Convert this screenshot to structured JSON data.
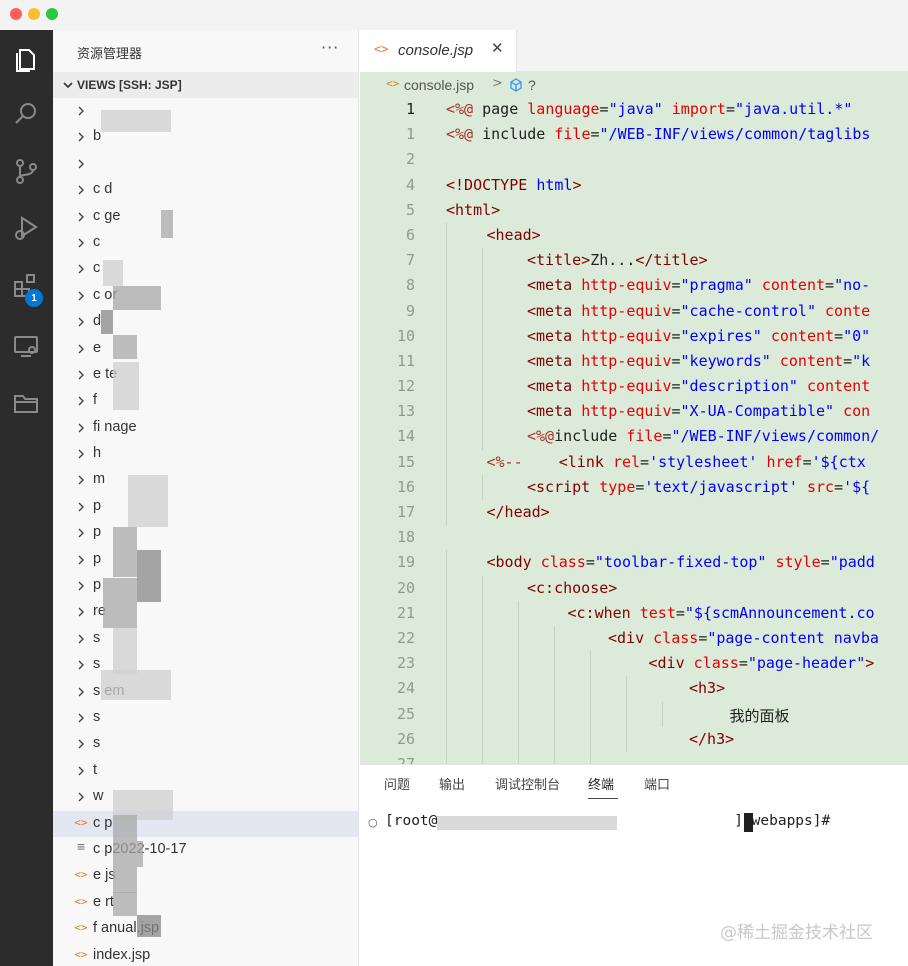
{
  "sidebar": {
    "title": "资源管理器",
    "more": "···",
    "section_label": "VIEWS [SSH: JSP]",
    "items": [
      {
        "label": "",
        "kind": "folder"
      },
      {
        "label": "b",
        "kind": "folder"
      },
      {
        "label": "",
        "kind": "folder"
      },
      {
        "label": "c    d",
        "kind": "folder"
      },
      {
        "label": "c             ge",
        "kind": "folder"
      },
      {
        "label": "c",
        "kind": "folder"
      },
      {
        "label": "c",
        "kind": "folder"
      },
      {
        "label": "c            or",
        "kind": "folder"
      },
      {
        "label": "d",
        "kind": "folder"
      },
      {
        "label": "e",
        "kind": "folder"
      },
      {
        "label": "e           te",
        "kind": "folder"
      },
      {
        "label": "f",
        "kind": "folder"
      },
      {
        "label": "fi                  nage",
        "kind": "folder"
      },
      {
        "label": "h",
        "kind": "folder"
      },
      {
        "label": "m",
        "kind": "folder"
      },
      {
        "label": "p",
        "kind": "folder"
      },
      {
        "label": "p",
        "kind": "folder"
      },
      {
        "label": "p",
        "kind": "folder"
      },
      {
        "label": "p",
        "kind": "folder"
      },
      {
        "label": "re",
        "kind": "folder"
      },
      {
        "label": "s",
        "kind": "folder"
      },
      {
        "label": "s",
        "kind": "folder"
      },
      {
        "label": "s                 em",
        "kind": "folder"
      },
      {
        "label": "s",
        "kind": "folder"
      },
      {
        "label": "s",
        "kind": "folder"
      },
      {
        "label": "t",
        "kind": "folder"
      },
      {
        "label": "w",
        "kind": "folder"
      },
      {
        "label": "c               p",
        "kind": "jsp"
      },
      {
        "label": "c            p2022-10-17",
        "kind": "text"
      },
      {
        "label": "e      js",
        "kind": "jsp"
      },
      {
        "label": "e      rt",
        "kind": "jsp"
      },
      {
        "label": "f         anual.jsp",
        "kind": "jsp"
      },
      {
        "label": "index.jsp",
        "kind": "jsp"
      }
    ],
    "selected_index": 27
  },
  "activity_badge": "1",
  "tab": {
    "icon": "<>",
    "label": "console.jsp",
    "close": "✕"
  },
  "breadcrumb": {
    "icon": "<>",
    "file": "console.jsp",
    "sep": ">",
    "tail": "?"
  },
  "code": [
    {
      "n": "1",
      "active": true,
      "indent": 0,
      "tokens": [
        [
          "jsp",
          "<%@"
        ],
        [
          "txt",
          " page "
        ],
        [
          "attr",
          "language"
        ],
        [
          "txt",
          "="
        ],
        [
          "str",
          "\"java\""
        ],
        [
          "txt",
          " "
        ],
        [
          "attr",
          "import"
        ],
        [
          "txt",
          "="
        ],
        [
          "str",
          "\"java.util.*\""
        ]
      ]
    },
    {
      "n": "1",
      "indent": 0,
      "tokens": [
        [
          "jsp",
          "<%@"
        ],
        [
          "txt",
          " include "
        ],
        [
          "attr",
          "file"
        ],
        [
          "txt",
          "="
        ],
        [
          "str",
          "\"/WEB-INF/views/common/taglibs"
        ]
      ]
    },
    {
      "n": "2",
      "indent": 0,
      "tokens": []
    },
    {
      "n": "4",
      "indent": 0,
      "tokens": [
        [
          "doc",
          "<!DOCTYPE"
        ],
        [
          "txt",
          " "
        ],
        [
          "str",
          "html"
        ],
        [
          "doc",
          ">"
        ]
      ]
    },
    {
      "n": "5",
      "indent": 0,
      "tokens": [
        [
          "tag",
          "<html>"
        ]
      ]
    },
    {
      "n": "6",
      "indent": 1,
      "tokens": [
        [
          "tag",
          "<head>"
        ]
      ]
    },
    {
      "n": "7",
      "indent": 2,
      "tokens": [
        [
          "tag",
          "<title>"
        ],
        [
          "txt",
          "Zh..."
        ],
        [
          "tag",
          "</title>"
        ]
      ]
    },
    {
      "n": "8",
      "indent": 2,
      "tokens": [
        [
          "tag",
          "<meta "
        ],
        [
          "attr",
          "http-equiv"
        ],
        [
          "txt",
          "="
        ],
        [
          "str",
          "\"pragma\""
        ],
        [
          "txt",
          " "
        ],
        [
          "attr",
          "content"
        ],
        [
          "txt",
          "="
        ],
        [
          "str",
          "\"no-"
        ]
      ]
    },
    {
      "n": "9",
      "indent": 2,
      "tokens": [
        [
          "tag",
          "<meta "
        ],
        [
          "attr",
          "http-equiv"
        ],
        [
          "txt",
          "="
        ],
        [
          "str",
          "\"cache-control\""
        ],
        [
          "txt",
          " "
        ],
        [
          "attr",
          "conte"
        ]
      ]
    },
    {
      "n": "10",
      "indent": 2,
      "tokens": [
        [
          "tag",
          "<meta "
        ],
        [
          "attr",
          "http-equiv"
        ],
        [
          "txt",
          "="
        ],
        [
          "str",
          "\"expires\""
        ],
        [
          "txt",
          " "
        ],
        [
          "attr",
          "content"
        ],
        [
          "txt",
          "="
        ],
        [
          "str",
          "\"0\""
        ]
      ]
    },
    {
      "n": "11",
      "indent": 2,
      "tokens": [
        [
          "tag",
          "<meta "
        ],
        [
          "attr",
          "http-equiv"
        ],
        [
          "txt",
          "="
        ],
        [
          "str",
          "\"keywords\""
        ],
        [
          "txt",
          " "
        ],
        [
          "attr",
          "content"
        ],
        [
          "txt",
          "="
        ],
        [
          "str",
          "\"k"
        ]
      ]
    },
    {
      "n": "12",
      "indent": 2,
      "tokens": [
        [
          "tag",
          "<meta "
        ],
        [
          "attr",
          "http-equiv"
        ],
        [
          "txt",
          "="
        ],
        [
          "str",
          "\"description\""
        ],
        [
          "txt",
          " "
        ],
        [
          "attr",
          "content"
        ]
      ]
    },
    {
      "n": "13",
      "indent": 2,
      "tokens": [
        [
          "tag",
          "<meta "
        ],
        [
          "attr",
          "http-equiv"
        ],
        [
          "txt",
          "="
        ],
        [
          "str",
          "\"X-UA-Compatible\""
        ],
        [
          "txt",
          " "
        ],
        [
          "attr",
          "con"
        ]
      ]
    },
    {
      "n": "14",
      "indent": 2,
      "tokens": [
        [
          "jsp",
          "<%@"
        ],
        [
          "txt",
          "include "
        ],
        [
          "attr",
          "file"
        ],
        [
          "txt",
          "="
        ],
        [
          "str",
          "\"/WEB-INF/views/common/"
        ]
      ]
    },
    {
      "n": "15",
      "indent": 1,
      "tokens": [
        [
          "jsp",
          "<%--"
        ],
        [
          "txt",
          "    "
        ],
        [
          "tag",
          "<link "
        ],
        [
          "attr",
          "rel"
        ],
        [
          "txt",
          "="
        ],
        [
          "str",
          "'stylesheet'"
        ],
        [
          "txt",
          " "
        ],
        [
          "attr",
          "href"
        ],
        [
          "txt",
          "="
        ],
        [
          "str",
          "'${ctx"
        ]
      ]
    },
    {
      "n": "16",
      "indent": 2,
      "tokens": [
        [
          "tag",
          "<script "
        ],
        [
          "attr",
          "type"
        ],
        [
          "txt",
          "="
        ],
        [
          "str",
          "'text/javascript'"
        ],
        [
          "txt",
          " "
        ],
        [
          "attr",
          "src"
        ],
        [
          "txt",
          "="
        ],
        [
          "str",
          "'${"
        ]
      ]
    },
    {
      "n": "17",
      "indent": 1,
      "tokens": [
        [
          "tag",
          "</head>"
        ]
      ]
    },
    {
      "n": "18",
      "indent": 0,
      "tokens": []
    },
    {
      "n": "19",
      "indent": 1,
      "tokens": [
        [
          "tag",
          "<body "
        ],
        [
          "attr",
          "class"
        ],
        [
          "txt",
          "="
        ],
        [
          "str",
          "\"toolbar-fixed-top\""
        ],
        [
          "txt",
          " "
        ],
        [
          "attr",
          "style"
        ],
        [
          "txt",
          "="
        ],
        [
          "str",
          "\"padd"
        ]
      ]
    },
    {
      "n": "20",
      "indent": 2,
      "tokens": [
        [
          "tag",
          "<c:choose>"
        ]
      ]
    },
    {
      "n": "21",
      "indent": 3,
      "tokens": [
        [
          "tag",
          "<c:when "
        ],
        [
          "attr",
          "test"
        ],
        [
          "txt",
          "="
        ],
        [
          "str",
          "\"${scmAnnouncement.co"
        ]
      ]
    },
    {
      "n": "22",
      "indent": 4,
      "tokens": [
        [
          "tag",
          "<div "
        ],
        [
          "attr",
          "class"
        ],
        [
          "txt",
          "="
        ],
        [
          "str",
          "\"page-content navba"
        ]
      ]
    },
    {
      "n": "23",
      "indent": 5,
      "tokens": [
        [
          "tag",
          "<div "
        ],
        [
          "attr",
          "class"
        ],
        [
          "txt",
          "="
        ],
        [
          "str",
          "\"page-header\""
        ],
        [
          "tag",
          ">"
        ]
      ]
    },
    {
      "n": "24",
      "indent": 6,
      "tokens": [
        [
          "tag",
          "<h3>"
        ]
      ]
    },
    {
      "n": "25",
      "indent": 7,
      "tokens": [
        [
          "txt",
          "我的面板"
        ]
      ]
    },
    {
      "n": "26",
      "indent": 6,
      "tokens": [
        [
          "tag",
          "</h3>"
        ]
      ]
    },
    {
      "n": "27",
      "indent": 5,
      "tokens": [
        [
          "tag",
          "..."
        ]
      ]
    }
  ],
  "panel": {
    "tabs": [
      "问题",
      "输出",
      "调试控制台",
      "终端",
      "端口"
    ],
    "active_tab": 3,
    "terminal_line": "[root@                                  ] webapps]#"
  },
  "watermark": "@稀土掘金技术社区",
  "colors": {
    "activity_bg": "#2c2c2c",
    "editor_bg": "#dcebd9",
    "tag": "#800000",
    "attr": "#e50000",
    "string": "#0000ff",
    "accent_badge": "#0078d4"
  }
}
